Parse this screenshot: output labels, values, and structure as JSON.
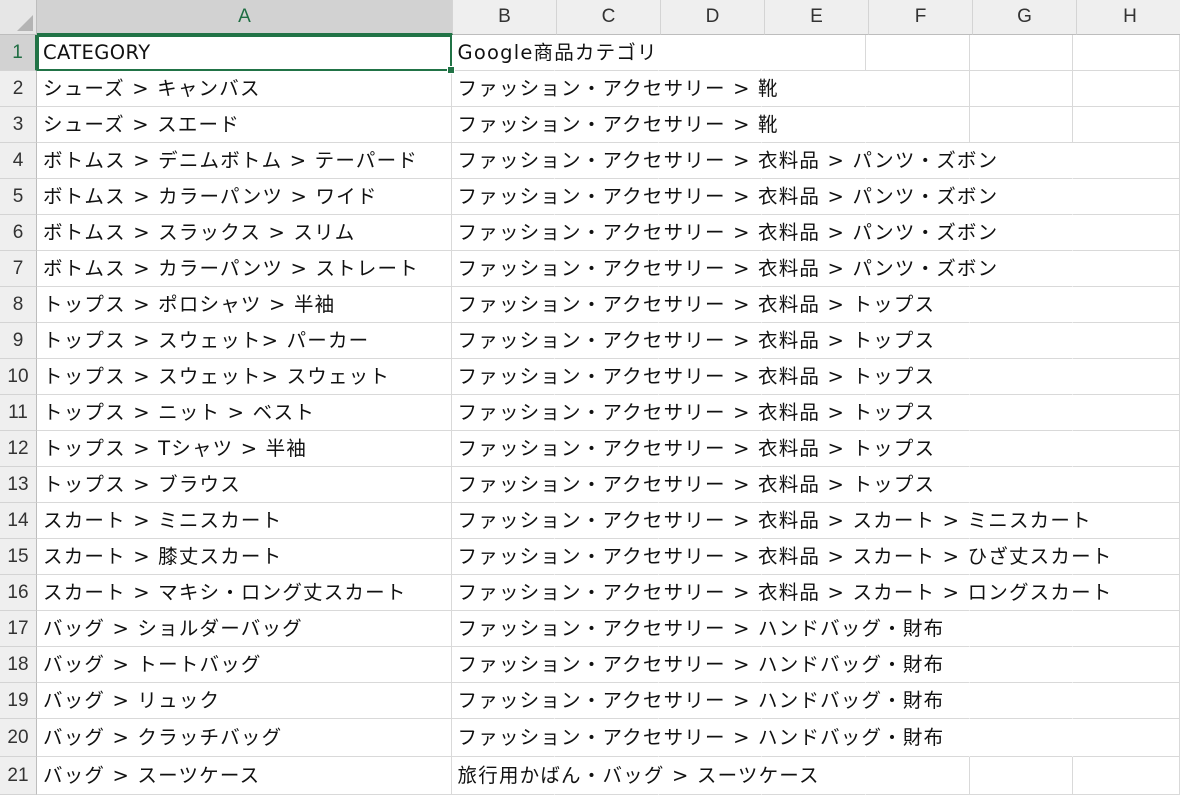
{
  "columns": [
    "A",
    "B",
    "C",
    "D",
    "E",
    "F",
    "G",
    "H"
  ],
  "selected_column": "A",
  "selected_row": "1",
  "rows": [
    {
      "num": "1",
      "a": "CATEGORY",
      "b": "Google商品カテゴリ"
    },
    {
      "num": "2",
      "a": "シューズ > キャンバス",
      "b": "ファッション・アクセサリー > 靴"
    },
    {
      "num": "3",
      "a": "シューズ > スエード",
      "b": "ファッション・アクセサリー > 靴"
    },
    {
      "num": "4",
      "a": "ボトムス > デニムボトム > テーパード",
      "b": "ファッション・アクセサリー > 衣料品 > パンツ・ズボン"
    },
    {
      "num": "5",
      "a": "ボトムス > カラーパンツ > ワイド",
      "b": "ファッション・アクセサリー > 衣料品 > パンツ・ズボン"
    },
    {
      "num": "6",
      "a": "ボトムス > スラックス > スリム",
      "b": "ファッション・アクセサリー > 衣料品 > パンツ・ズボン"
    },
    {
      "num": "7",
      "a": "ボトムス > カラーパンツ > ストレート",
      "b": "ファッション・アクセサリー > 衣料品 > パンツ・ズボン"
    },
    {
      "num": "8",
      "a": "トップス > ポロシャツ > 半袖",
      "b": "ファッション・アクセサリー > 衣料品 > トップス"
    },
    {
      "num": "9",
      "a": "トップス > スウェット> パーカー",
      "b": "ファッション・アクセサリー > 衣料品 > トップス"
    },
    {
      "num": "10",
      "a": "トップス > スウェット> スウェット",
      "b": "ファッション・アクセサリー > 衣料品 > トップス"
    },
    {
      "num": "11",
      "a": "トップス > ニット > ベスト",
      "b": "ファッション・アクセサリー > 衣料品 > トップス"
    },
    {
      "num": "12",
      "a": "トップス > Tシャツ > 半袖",
      "b": "ファッション・アクセサリー > 衣料品 > トップス"
    },
    {
      "num": "13",
      "a": "トップス > ブラウス",
      "b": "ファッション・アクセサリー > 衣料品 > トップス"
    },
    {
      "num": "14",
      "a": "スカート > ミニスカート",
      "b": "ファッション・アクセサリー > 衣料品 > スカート > ミニスカート"
    },
    {
      "num": "15",
      "a": "スカート > 膝丈スカート",
      "b": "ファッション・アクセサリー > 衣料品 > スカート > ひざ丈スカート"
    },
    {
      "num": "16",
      "a": "スカート > マキシ・ロング丈スカート",
      "b": "ファッション・アクセサリー > 衣料品 > スカート > ロングスカート"
    },
    {
      "num": "17",
      "a": "バッグ > ショルダーバッグ",
      "b": "ファッション・アクセサリー > ハンドバッグ・財布"
    },
    {
      "num": "18",
      "a": "バッグ > トートバッグ",
      "b": "ファッション・アクセサリー > ハンドバッグ・財布"
    },
    {
      "num": "19",
      "a": "バッグ > リュック",
      "b": "ファッション・アクセサリー > ハンドバッグ・財布"
    },
    {
      "num": "20",
      "a": "バッグ > クラッチバッグ",
      "b": "ファッション・アクセサリー > ハンドバッグ・財布"
    },
    {
      "num": "21",
      "a": "バッグ > スーツケース",
      "b": "旅行用かばん・バッグ > スーツケース"
    }
  ],
  "colors": {
    "accent": "#217346",
    "header_bg": "#efefef",
    "header_selected_bg": "#d2d2d2",
    "gridline": "#d9d9d9"
  }
}
